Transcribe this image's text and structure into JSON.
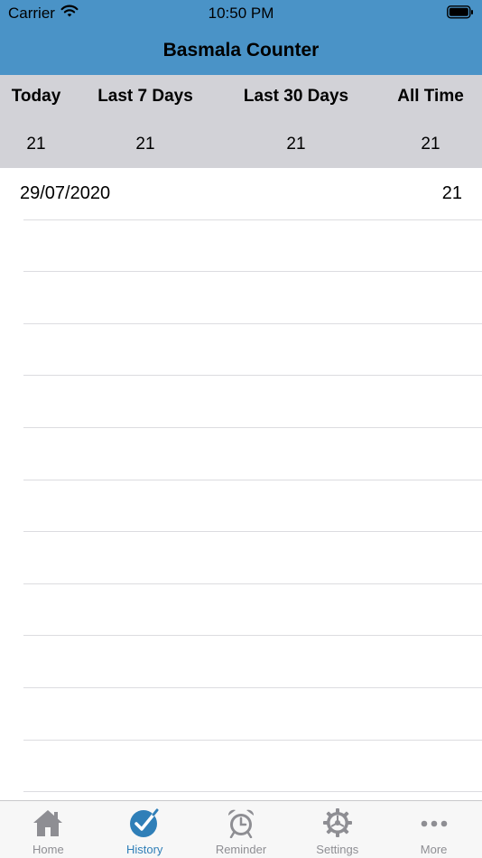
{
  "status_bar": {
    "carrier": "Carrier",
    "time": "10:50 PM"
  },
  "nav": {
    "title": "Basmala Counter"
  },
  "summary": [
    {
      "label": "Today",
      "value": "21"
    },
    {
      "label": "Last 7 Days",
      "value": "21"
    },
    {
      "label": "Last 30 Days",
      "value": "21"
    },
    {
      "label": "All Time",
      "value": "21"
    }
  ],
  "history": [
    {
      "date": "29/07/2020",
      "count": "21"
    }
  ],
  "tabs": [
    {
      "label": "Home",
      "icon": "home-icon"
    },
    {
      "label": "History",
      "icon": "checkmark-circle-icon",
      "active": true
    },
    {
      "label": "Reminder",
      "icon": "alarm-clock-icon"
    },
    {
      "label": "Settings",
      "icon": "gear-icon"
    },
    {
      "label": "More",
      "icon": "more-dots-icon"
    }
  ],
  "colors": {
    "header": "#4a93c7",
    "summary_bg": "#d2d2d7",
    "tab_active": "#2f7fb8",
    "tab_inactive": "#8e8e93"
  }
}
